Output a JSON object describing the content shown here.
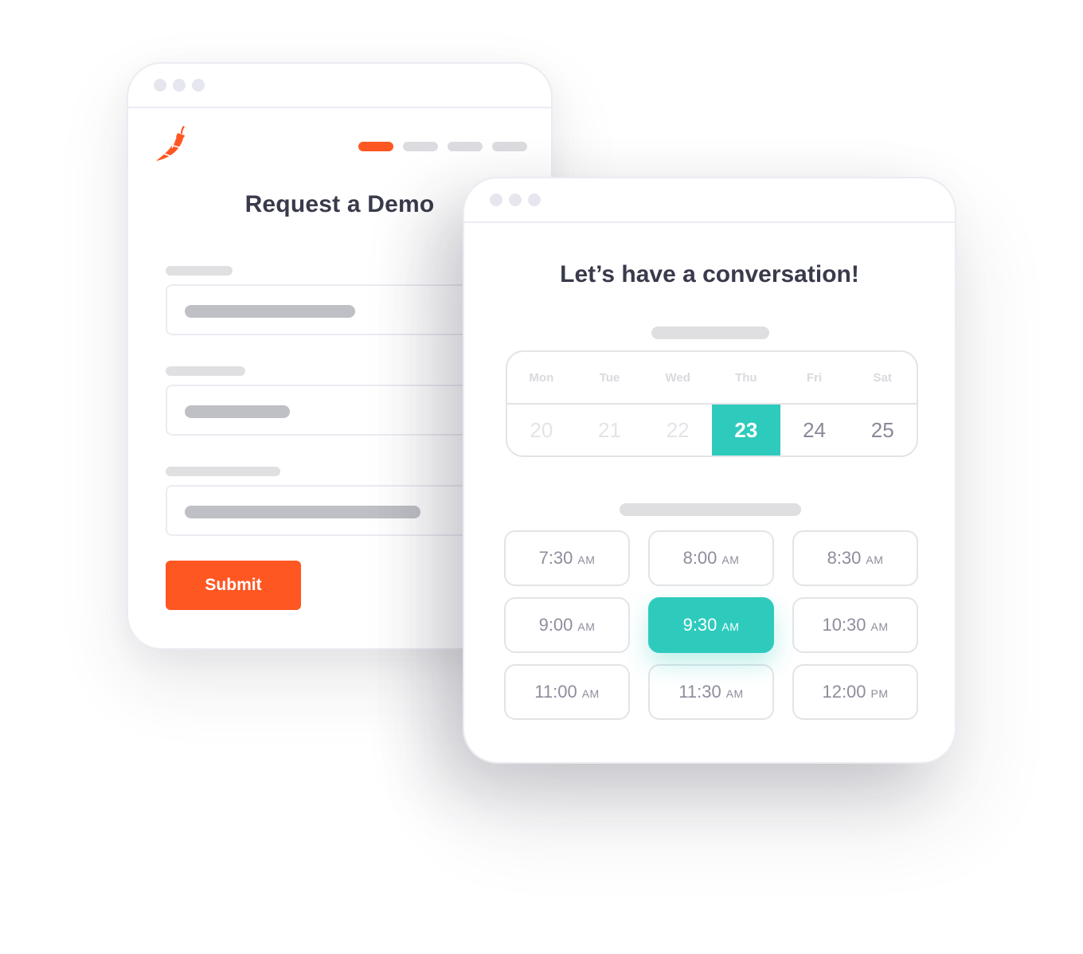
{
  "colors": {
    "brand_orange": "#ff5722",
    "accent_teal": "#2ecbbd",
    "heading": "#393a4b",
    "muted_text": "#8f8d9c"
  },
  "request_form": {
    "logo_icon": "chili-pepper-icon",
    "steps": [
      {
        "active": true
      },
      {
        "active": false
      },
      {
        "active": false
      },
      {
        "active": false
      }
    ],
    "title": "Request a Demo",
    "submit_label": "Submit"
  },
  "scheduler": {
    "title": "Let’s have a conversation!",
    "calendar": {
      "days": [
        {
          "name": "Mon",
          "date": "20",
          "state": "unavailable"
        },
        {
          "name": "Tue",
          "date": "21",
          "state": "unavailable"
        },
        {
          "name": "Wed",
          "date": "22",
          "state": "unavailable"
        },
        {
          "name": "Thu",
          "date": "23",
          "state": "selected"
        },
        {
          "name": "Fri",
          "date": "24",
          "state": "available"
        },
        {
          "name": "Sat",
          "date": "25",
          "state": "available"
        }
      ]
    },
    "time_slots": [
      {
        "time": "7:30",
        "meridiem": "AM",
        "selected": false
      },
      {
        "time": "8:00",
        "meridiem": "AM",
        "selected": false
      },
      {
        "time": "8:30",
        "meridiem": "AM",
        "selected": false
      },
      {
        "time": "9:00",
        "meridiem": "AM",
        "selected": false
      },
      {
        "time": "9:30",
        "meridiem": "AM",
        "selected": true
      },
      {
        "time": "10:30",
        "meridiem": "AM",
        "selected": false
      },
      {
        "time": "11:00",
        "meridiem": "AM",
        "selected": false
      },
      {
        "time": "11:30",
        "meridiem": "AM",
        "selected": false
      },
      {
        "time": "12:00",
        "meridiem": "PM",
        "selected": false
      }
    ]
  }
}
